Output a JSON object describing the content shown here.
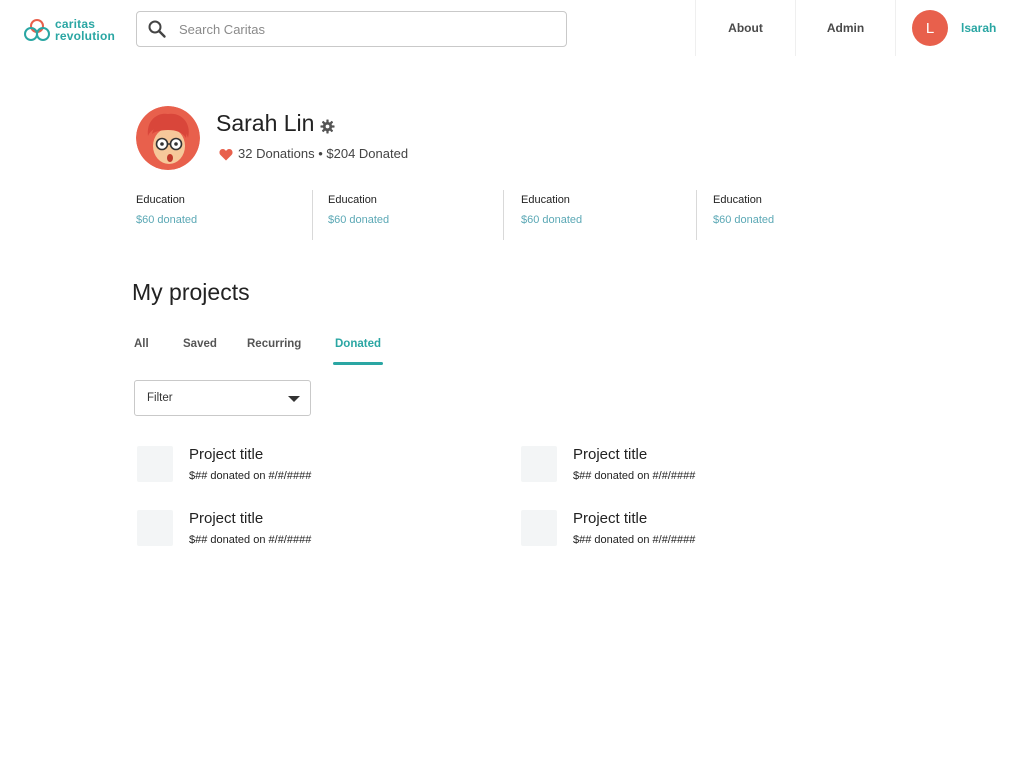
{
  "header": {
    "logo_line1": "caritas",
    "logo_line2": "revolution",
    "search_placeholder": "Search Caritas",
    "nav": {
      "about": "About",
      "admin": "Admin"
    },
    "user": {
      "initial": "L",
      "name": "lsarah"
    }
  },
  "profile": {
    "name": "Sarah Lin",
    "stats": "32 Donations • $204 Donated",
    "categories": [
      {
        "name": "Education",
        "amount": "$60 donated"
      },
      {
        "name": "Education",
        "amount": "$60 donated"
      },
      {
        "name": "Education",
        "amount": "$60 donated"
      },
      {
        "name": "Education",
        "amount": "$60 donated"
      }
    ]
  },
  "projects": {
    "title": "My projects",
    "tabs": [
      {
        "label": "All"
      },
      {
        "label": "Saved"
      },
      {
        "label": "Recurring"
      },
      {
        "label": "Donated"
      }
    ],
    "active_tab": "Donated",
    "filter_label": "Filter",
    "items": [
      {
        "title": "Project title",
        "meta": "$## donated on #/#/####"
      },
      {
        "title": "Project title",
        "meta": "$## donated on #/#/####"
      },
      {
        "title": "Project title",
        "meta": "$## donated on #/#/####"
      },
      {
        "title": "Project title",
        "meta": "$## donated on #/#/####"
      }
    ]
  },
  "colors": {
    "accent": "#2aa6a3",
    "avatar": "#e8604c",
    "amount_text": "#5ba8b5"
  },
  "icons": [
    "logo-icon",
    "search-icon",
    "gear-icon",
    "heart-icon",
    "chevron-down-icon"
  ]
}
